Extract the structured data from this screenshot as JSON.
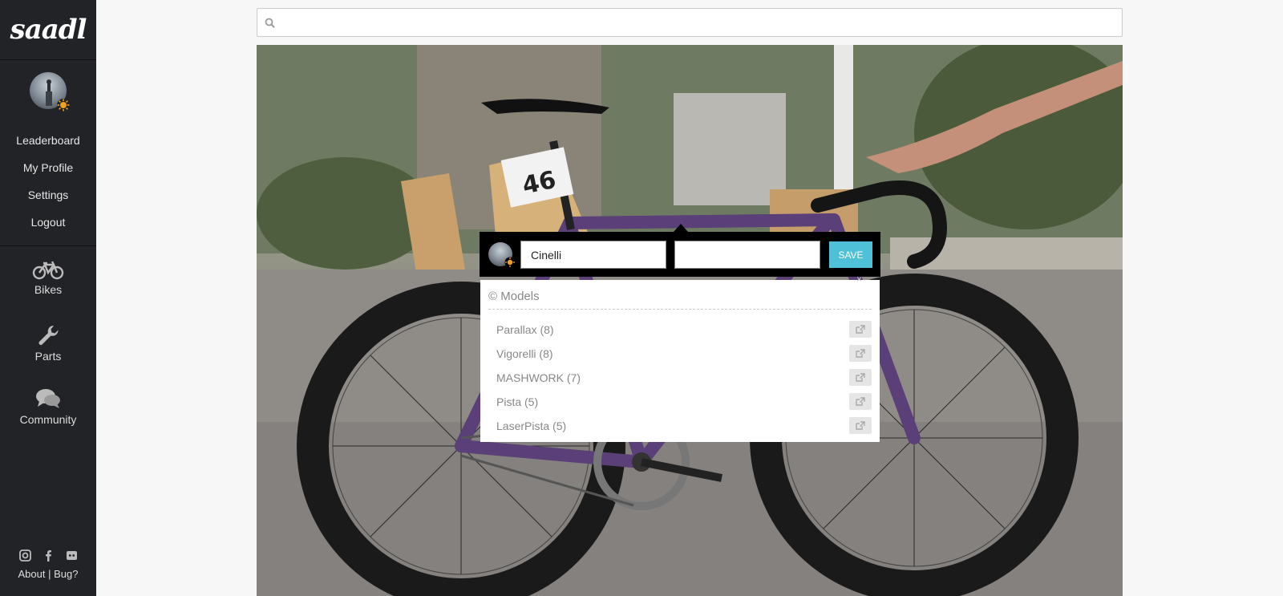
{
  "app": {
    "logo": "saadl"
  },
  "sidebar": {
    "links": [
      {
        "label": "Leaderboard"
      },
      {
        "label": "My Profile"
      },
      {
        "label": "Settings"
      },
      {
        "label": "Logout"
      }
    ],
    "sections": [
      {
        "label": "Bikes",
        "icon": "bicycle-icon"
      },
      {
        "label": "Parts",
        "icon": "wrench-icon"
      },
      {
        "label": "Community",
        "icon": "comments-icon"
      }
    ],
    "footer": {
      "social_icons": [
        "instagram-icon",
        "facebook-icon",
        "discord-icon"
      ],
      "about": "About",
      "separator": "|",
      "bug": "Bug?"
    }
  },
  "search": {
    "placeholder": "",
    "value": ""
  },
  "photo": {
    "number_tag": "46"
  },
  "tag_editor": {
    "brand_value": "Cinelli",
    "model_value": "",
    "save_label": "SAVE"
  },
  "dropdown": {
    "close_glyph": "×",
    "header_symbol": "©",
    "header_label": "Models",
    "items": [
      {
        "label": "Parallax (8)"
      },
      {
        "label": "Vigorelli (8)"
      },
      {
        "label": "MASHWORK (7)"
      },
      {
        "label": "Pista (5)"
      },
      {
        "label": "LaserPista (5)"
      }
    ]
  },
  "colors": {
    "sidebar_bg": "#222327",
    "accent": "#4ec1d8",
    "badge": "#f0a21c",
    "frame": "#5a3f78"
  }
}
